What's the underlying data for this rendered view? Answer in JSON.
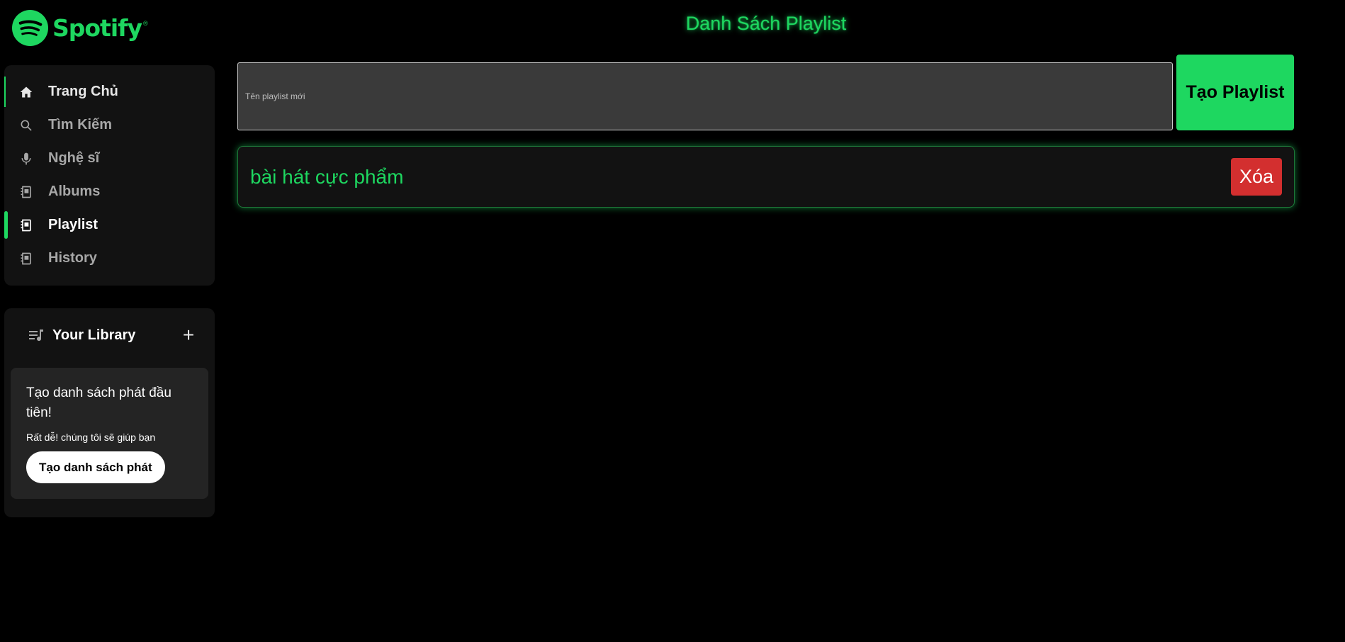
{
  "brand": {
    "name": "Spotify",
    "trademark": "®",
    "color": "#1ed760"
  },
  "nav": {
    "items": [
      {
        "label": "Trang Chủ",
        "icon": "home-icon"
      },
      {
        "label": "Tìm Kiếm",
        "icon": "search-icon"
      },
      {
        "label": "Nghệ sĩ",
        "icon": "microphone-icon"
      },
      {
        "label": "Albums",
        "icon": "album-icon"
      },
      {
        "label": "Playlist",
        "icon": "playlist-icon",
        "active": true
      },
      {
        "label": "History",
        "icon": "history-icon"
      }
    ]
  },
  "library": {
    "title": "Your Library",
    "icon": "library-icon",
    "add_icon": "plus-icon",
    "card": {
      "title": "Tạo danh sách phát đầu tiên!",
      "subtitle": "Rất dễ! chúng tôi sẽ giúp bạn",
      "button": "Tạo danh sách phát"
    }
  },
  "main": {
    "title": "Danh Sách Playlist",
    "input_placeholder": "Tên playlist mới",
    "input_value": "",
    "create_button": "Tạo Playlist",
    "playlists": [
      {
        "name": "bài hát cực phẩm",
        "delete_label": "Xóa"
      }
    ]
  },
  "colors": {
    "accent": "#1ed760",
    "danger": "#d32f2f",
    "panel": "#121212",
    "card": "#242424"
  }
}
